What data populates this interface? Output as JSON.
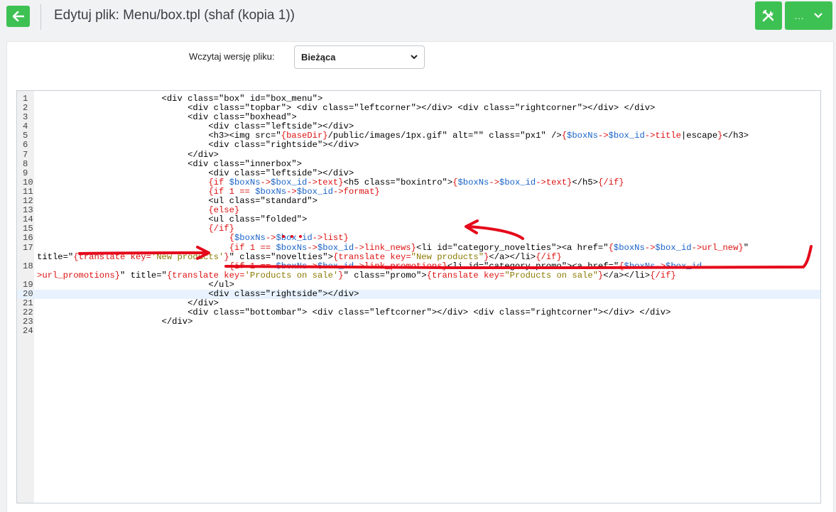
{
  "header": {
    "title": "Edytuj plik: Menu/box.tpl (shaf (kopia 1))",
    "more_label": "..."
  },
  "version": {
    "label": "Wczytaj wersję pliku:",
    "selected": "Bieżąca"
  },
  "editor": {
    "lines": [
      {
        "n": "1",
        "segs": [
          [
            "t",
            "                        <div class=\"box\" id=\"box_menu\">"
          ]
        ]
      },
      {
        "n": "2",
        "segs": [
          [
            "t",
            "                             <div class=\"topbar\"> <div class=\"leftcorner\"></div> <div class=\"rightcorner\"></div> </div>"
          ]
        ]
      },
      {
        "n": "3",
        "segs": [
          [
            "t",
            "                             <div class=\"boxhead\">"
          ]
        ]
      },
      {
        "n": "4",
        "segs": [
          [
            "t",
            "                                 <div class=\"leftside\"></div>"
          ]
        ]
      },
      {
        "n": "5",
        "segs": [
          [
            "t",
            "                                 <h3><img src=\""
          ],
          [
            "k",
            "{baseDir}"
          ],
          [
            "t",
            "/public/images/1px.gif\" alt=\"\" class=\"px1\" />"
          ],
          [
            "k",
            "{"
          ],
          [
            "v",
            "$boxNs"
          ],
          [
            "k",
            "->"
          ],
          [
            "v",
            "$box_id"
          ],
          [
            "k",
            "->title"
          ],
          [
            "t",
            "|escape"
          ],
          [
            "k",
            "}"
          ],
          [
            "t",
            "</h3>"
          ]
        ]
      },
      {
        "n": "6",
        "segs": [
          [
            "t",
            "                                 <div class=\"rightside\"></div>"
          ]
        ]
      },
      {
        "n": "7",
        "segs": [
          [
            "t",
            "                             </div>"
          ]
        ]
      },
      {
        "n": "8",
        "segs": [
          [
            "t",
            "                             <div class=\"innerbox\">"
          ]
        ]
      },
      {
        "n": "9",
        "segs": [
          [
            "t",
            "                                 <div class=\"leftside\"></div>"
          ]
        ]
      },
      {
        "n": "10",
        "segs": [
          [
            "t",
            "                                 "
          ],
          [
            "k",
            "{if "
          ],
          [
            "v",
            "$boxNs"
          ],
          [
            "k",
            "->"
          ],
          [
            "v",
            "$box_id"
          ],
          [
            "k",
            "->text}"
          ],
          [
            "t",
            "<h5 class=\"boxintro\">"
          ],
          [
            "k",
            "{"
          ],
          [
            "v",
            "$boxNs"
          ],
          [
            "k",
            "->"
          ],
          [
            "v",
            "$box_id"
          ],
          [
            "k",
            "->text}"
          ],
          [
            "t",
            "</h5>"
          ],
          [
            "k",
            "{/if}"
          ]
        ]
      },
      {
        "n": "11",
        "segs": [
          [
            "t",
            "                                 "
          ],
          [
            "k",
            "{if 1 == "
          ],
          [
            "v",
            "$boxNs"
          ],
          [
            "k",
            "->"
          ],
          [
            "v",
            "$box_id"
          ],
          [
            "k",
            "->format}"
          ]
        ]
      },
      {
        "n": "12",
        "segs": [
          [
            "t",
            "                                 <ul class=\"standard\">"
          ]
        ]
      },
      {
        "n": "13",
        "segs": [
          [
            "t",
            "                                 "
          ],
          [
            "k",
            "{else}"
          ]
        ]
      },
      {
        "n": "14",
        "segs": [
          [
            "t",
            "                                 <ul class=\"folded\">"
          ]
        ]
      },
      {
        "n": "15",
        "segs": [
          [
            "t",
            "                                 "
          ],
          [
            "k",
            "{/if}"
          ]
        ]
      },
      {
        "n": "16",
        "segs": [
          [
            "t",
            "                                     "
          ],
          [
            "k",
            "{"
          ],
          [
            "v",
            "$boxNs"
          ],
          [
            "k",
            "->"
          ],
          [
            "v",
            "$box_id"
          ],
          [
            "k",
            "->list}"
          ]
        ]
      },
      {
        "n": "17",
        "wrap": true,
        "segs": [
          [
            "t",
            "                                     "
          ],
          [
            "k",
            "{if 1 == "
          ],
          [
            "v",
            "$boxNs"
          ],
          [
            "k",
            "->"
          ],
          [
            "v",
            "$box_id"
          ],
          [
            "k",
            "->link_news}"
          ],
          [
            "t",
            "<li id=\"category_novelties\"><a href=\""
          ],
          [
            "k",
            "{"
          ],
          [
            "v",
            "$boxNs"
          ],
          [
            "k",
            "->"
          ],
          [
            "v",
            "$box_id"
          ],
          [
            "k",
            "->url_new}"
          ],
          [
            "t",
            "\""
          ]
        ],
        "segs2": [
          [
            "t",
            "title=\""
          ],
          [
            "k",
            "{translate key="
          ],
          [
            "s",
            "'New products'"
          ],
          [
            "k",
            "}"
          ],
          [
            "t",
            "\" class=\"novelties\">"
          ],
          [
            "k",
            "{translate key="
          ],
          [
            "s",
            "\"New products\""
          ],
          [
            "k",
            "}"
          ],
          [
            "t",
            "</a></li>"
          ],
          [
            "k",
            "{/if}"
          ]
        ]
      },
      {
        "n": "18",
        "wrap": true,
        "segs": [
          [
            "t",
            "                                     "
          ],
          [
            "k",
            "{if 1 == "
          ],
          [
            "v",
            "$boxNs"
          ],
          [
            "k",
            "->"
          ],
          [
            "v",
            "$box_id"
          ],
          [
            "k",
            "->link_promotions}"
          ],
          [
            "t",
            "<li id=\"category_promo\"><a href=\""
          ],
          [
            "k",
            "{"
          ],
          [
            "v",
            "$boxNs"
          ],
          [
            "k",
            "->"
          ],
          [
            "v",
            "$box_id-"
          ]
        ],
        "segs2": [
          [
            "k",
            ">url_promotions}"
          ],
          [
            "t",
            "\" title=\""
          ],
          [
            "k",
            "{translate key="
          ],
          [
            "s",
            "'Products on sale'"
          ],
          [
            "k",
            "}"
          ],
          [
            "t",
            "\" class=\"promo\">"
          ],
          [
            "k",
            "{translate key="
          ],
          [
            "s",
            "\"Products on sale\""
          ],
          [
            "k",
            "}"
          ],
          [
            "t",
            "</a></li>"
          ],
          [
            "k",
            "{/if}"
          ]
        ]
      },
      {
        "n": "19",
        "segs": [
          [
            "t",
            "                                 </ul>"
          ]
        ]
      },
      {
        "n": "20",
        "active": true,
        "segs": [
          [
            "t",
            "                                 <div class=\"rightside\"></div>"
          ]
        ]
      },
      {
        "n": "21",
        "segs": [
          [
            "t",
            "                             </div>"
          ]
        ]
      },
      {
        "n": "22",
        "segs": [
          [
            "t",
            "                             <div class=\"bottombar\"> <div class=\"leftcorner\"></div> <div class=\"rightcorner\"></div> </div>"
          ]
        ]
      },
      {
        "n": "23",
        "segs": [
          [
            "t",
            "                        </div>"
          ]
        ]
      },
      {
        "n": "24",
        "segs": [
          [
            "t",
            ""
          ]
        ]
      }
    ]
  },
  "colors": {
    "accent_green": "#3ec153",
    "annotation_red": "#e5091b",
    "smarty_red": "#dd1111",
    "variable_blue": "#1a64c8",
    "string_olive": "#8b7a00"
  },
  "icons": [
    "arrow-left-icon",
    "tools-icon",
    "chevron-down-icon"
  ]
}
